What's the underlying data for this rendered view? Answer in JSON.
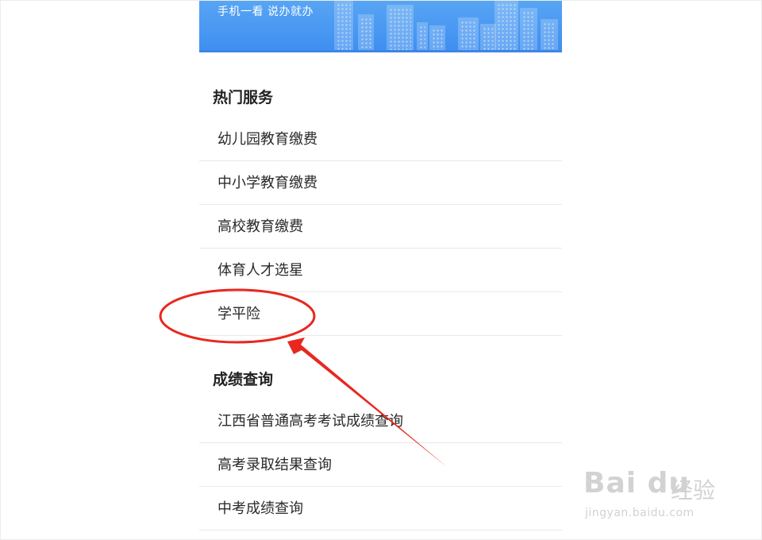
{
  "banner": {
    "slogan": "手机一看 说办就办",
    "colors": {
      "top": "#58a5f4",
      "bottom": "#3e8ef0"
    }
  },
  "sections": [
    {
      "title": "热门服务",
      "items": [
        {
          "label": "幼儿园教育缴费"
        },
        {
          "label": "中小学教育缴费"
        },
        {
          "label": "高校教育缴费"
        },
        {
          "label": "体育人才选星"
        },
        {
          "label": "学平险",
          "highlighted": true
        }
      ]
    },
    {
      "title": "成绩查询",
      "items": [
        {
          "label": "江西省普通高考考试成绩查询"
        },
        {
          "label": "高考录取结果查询"
        },
        {
          "label": "中考成绩查询"
        }
      ]
    }
  ],
  "annotation": {
    "color": "#e8281f",
    "icon": "red-circle-and-arrow"
  },
  "watermark": {
    "logo": "Bai du",
    "brand": "经验",
    "url": "jingyan.baidu.com"
  }
}
